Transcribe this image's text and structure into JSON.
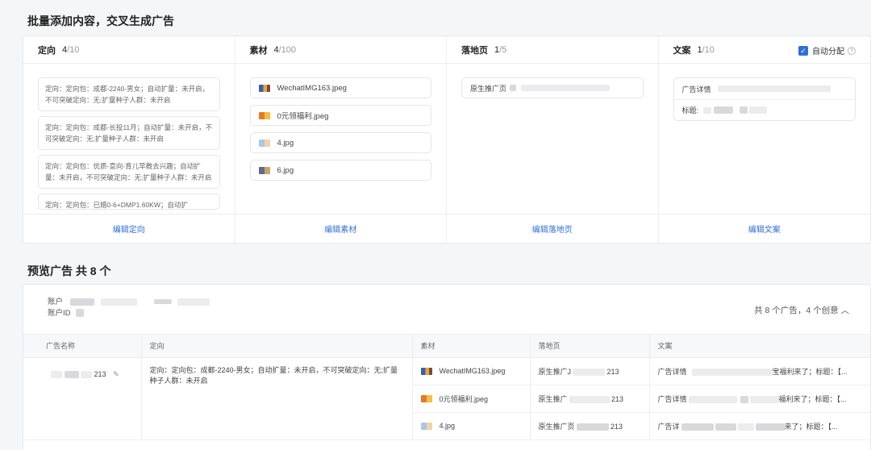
{
  "batch": {
    "title": "批量添加内容，交叉生成广告",
    "columns": {
      "targeting": {
        "title": "定向",
        "count": "4",
        "total": "/10",
        "footer": "编辑定向",
        "items": [
          "定向：定向包：成都-2240-男女；自动扩量：未开启，不可突破定向：无;扩量种子人群：未开启",
          "定向：定向包：成都-长投11月；自动扩量：未开启，不可突破定向：无;扩量种子人群：未开启",
          "定向：定向包：优质-意向-育儿早教去兴趣；自动扩量：未开启，不可突破定向：无;扩量种子人群：未开启",
          "定向：定向包：已婚0-6+DMP1.60KW；自动扩"
        ]
      },
      "material": {
        "title": "素材",
        "count": "4",
        "total": "/100",
        "footer": "编辑素材",
        "items": [
          "WechatIMG163.jpeg",
          "0元领福利.jpeg",
          "4.jpg",
          "6.jpg"
        ]
      },
      "landing": {
        "title": "落地页",
        "count": "1",
        "total": "/5",
        "footer": "编辑落地页",
        "items": [
          "原生推广页"
        ]
      },
      "copy": {
        "title": "文案",
        "count": "1",
        "total": "/10",
        "footer": "编辑文案",
        "auto_label": "自动分配",
        "auto_checked": true,
        "detail_label": "广告详情",
        "headline_label": "标题:"
      }
    }
  },
  "preview": {
    "title": "预览广告 共 8 个",
    "account_label": "账户",
    "account_id_label": "账户ID",
    "summary": "共 8 个广告，4 个创意",
    "headers": [
      "广告名称",
      "定向",
      "素材",
      "落地页",
      "文案"
    ],
    "ad_name_suffix": "213",
    "targeting": "定向：定向包：成都-2240-男女；自动扩量：未开启，不可突破定向：无;扩量种子人群：未开启",
    "rows": [
      {
        "material": "WechatIMG163.jpeg",
        "landing": "原生推广J",
        "landing_suffix": "213",
        "copy": "广告详情",
        "copy_tail": "宝福利来了；标题：【..."
      },
      {
        "material": "0元领福利.jpeg",
        "landing": "原生推广",
        "landing_suffix": "213",
        "copy": "广告详情",
        "copy_tail": "福利来了；标题：【..."
      },
      {
        "material": "4.jpg",
        "landing": "原生推广页",
        "landing_suffix": "213",
        "copy": "广告详",
        "copy_tail": "来了；标题：【..."
      }
    ]
  }
}
